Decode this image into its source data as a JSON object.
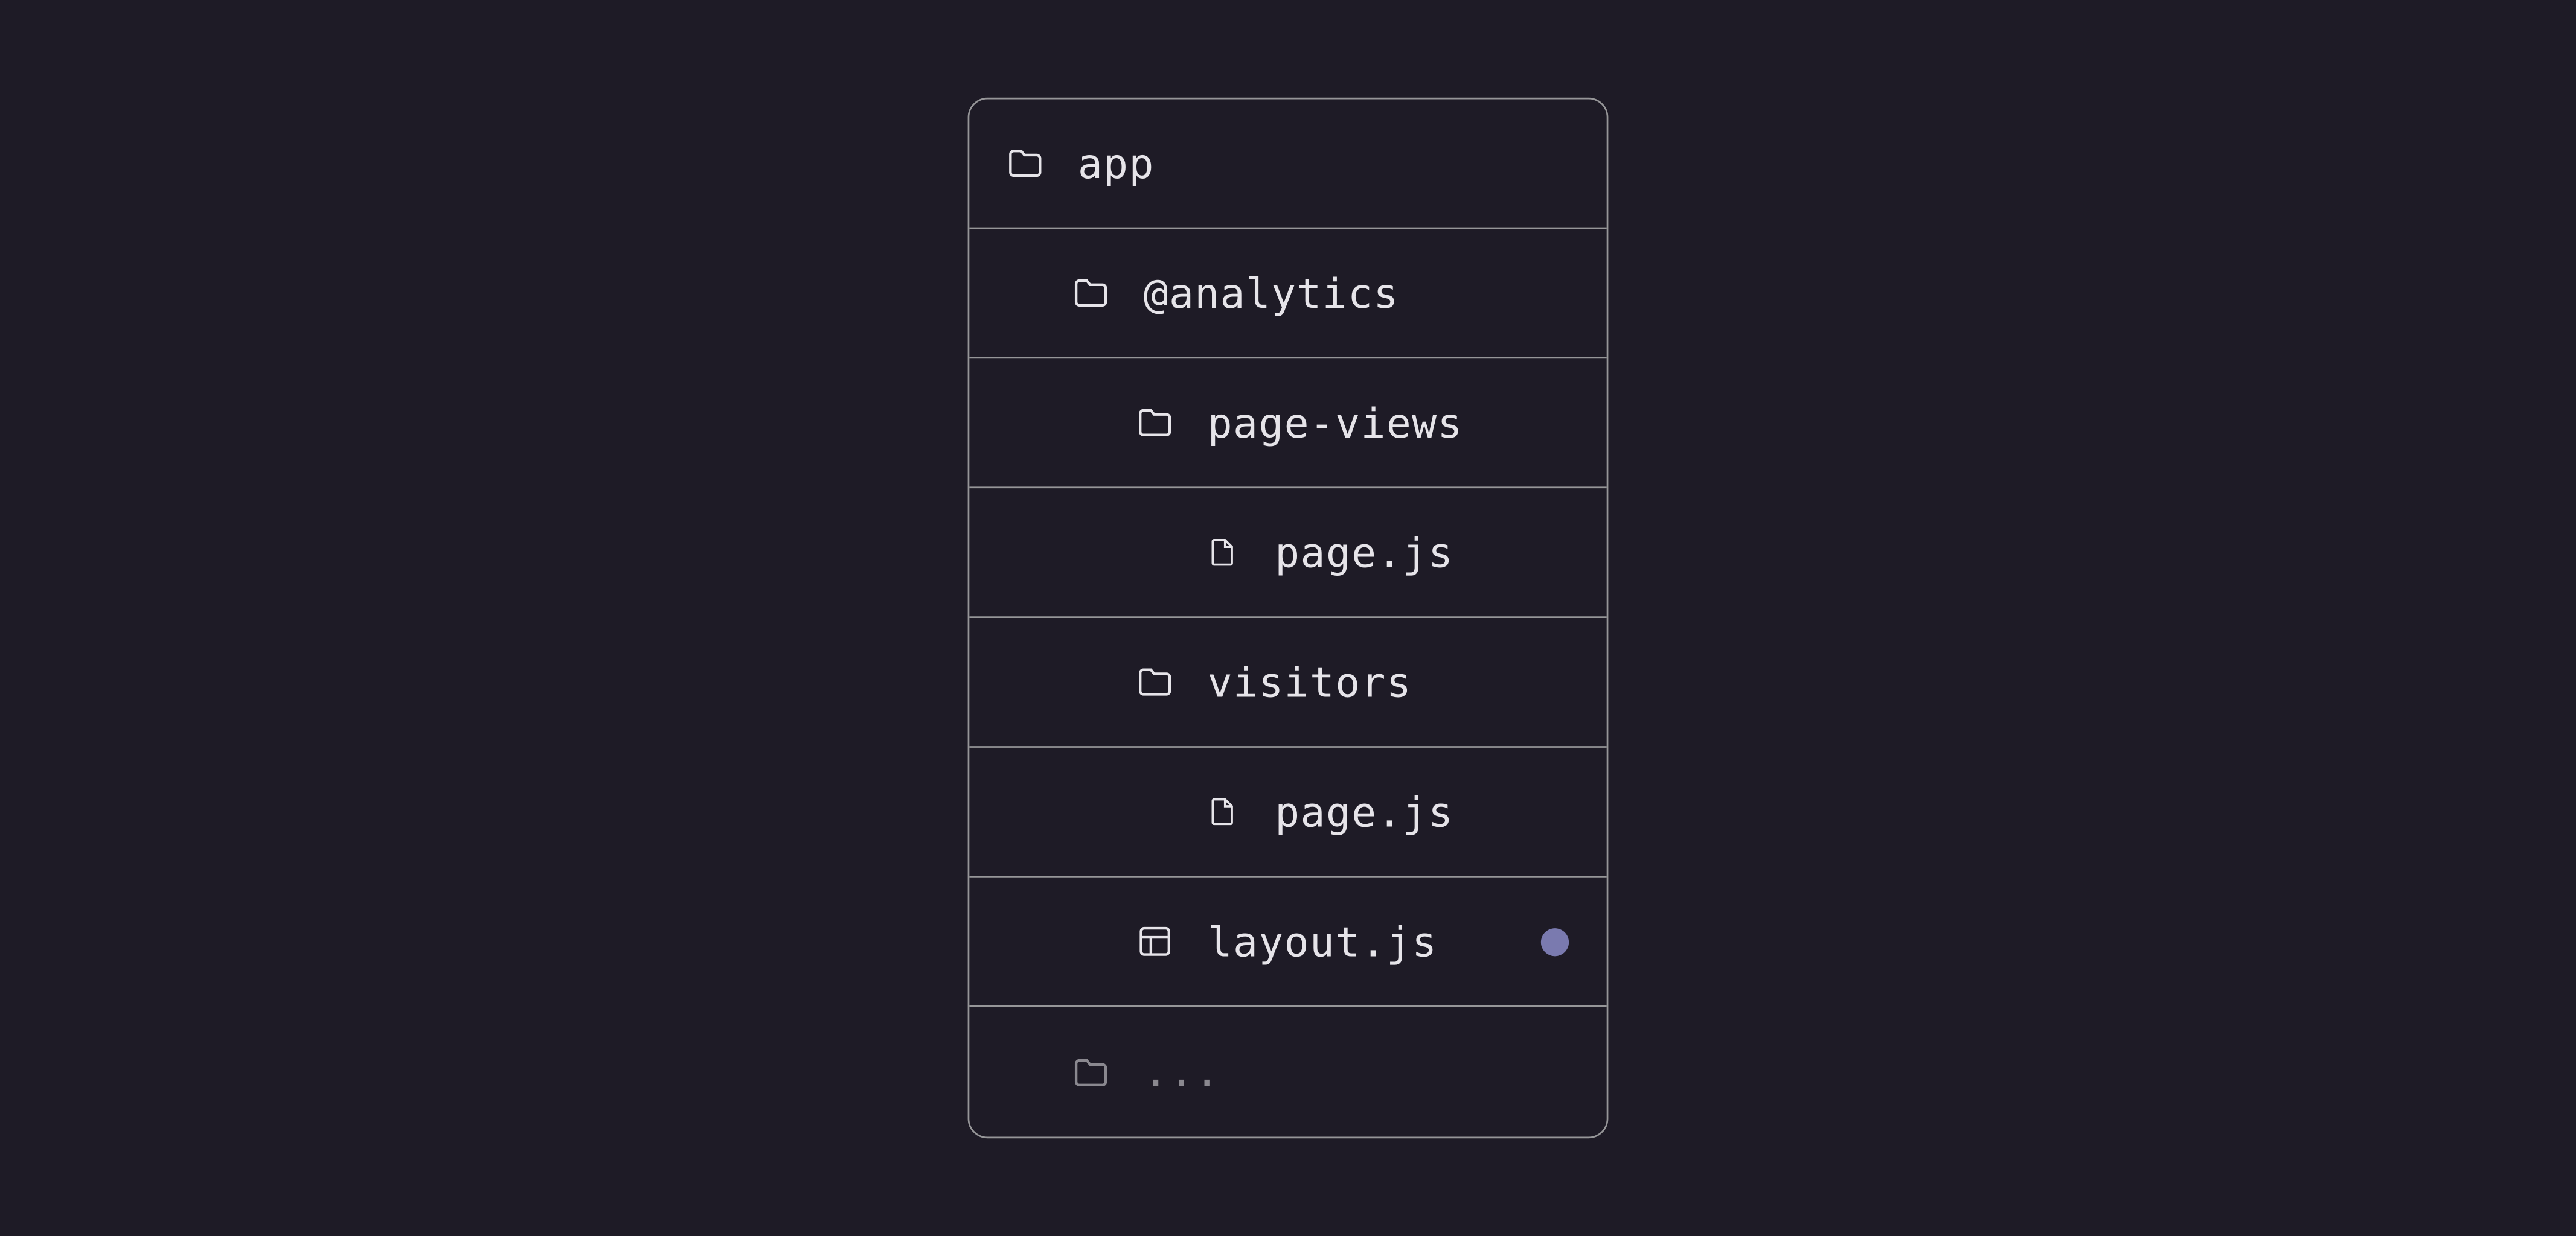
{
  "colors": {
    "background": "#1e1b26",
    "border": "#969698",
    "text": "#e6e4e9",
    "dimmed": "#8a888f",
    "accent_dot": "#7a7aaf"
  },
  "tree": {
    "rows": [
      {
        "icon": "folder",
        "label": "app",
        "indent": 0,
        "marker": false,
        "dimmed": false
      },
      {
        "icon": "folder",
        "label": "@analytics",
        "indent": 1,
        "marker": false,
        "dimmed": false
      },
      {
        "icon": "folder",
        "label": "page-views",
        "indent": 2,
        "marker": false,
        "dimmed": false
      },
      {
        "icon": "file",
        "label": "page.js",
        "indent": 3,
        "marker": false,
        "dimmed": false
      },
      {
        "icon": "folder",
        "label": "visitors",
        "indent": 2,
        "marker": false,
        "dimmed": false
      },
      {
        "icon": "file",
        "label": "page.js",
        "indent": 3,
        "marker": false,
        "dimmed": false
      },
      {
        "icon": "layout",
        "label": "layout.js",
        "indent": 2,
        "marker": true,
        "dimmed": false
      },
      {
        "icon": "folder",
        "label": "...",
        "indent": 1,
        "marker": false,
        "dimmed": true
      }
    ]
  }
}
